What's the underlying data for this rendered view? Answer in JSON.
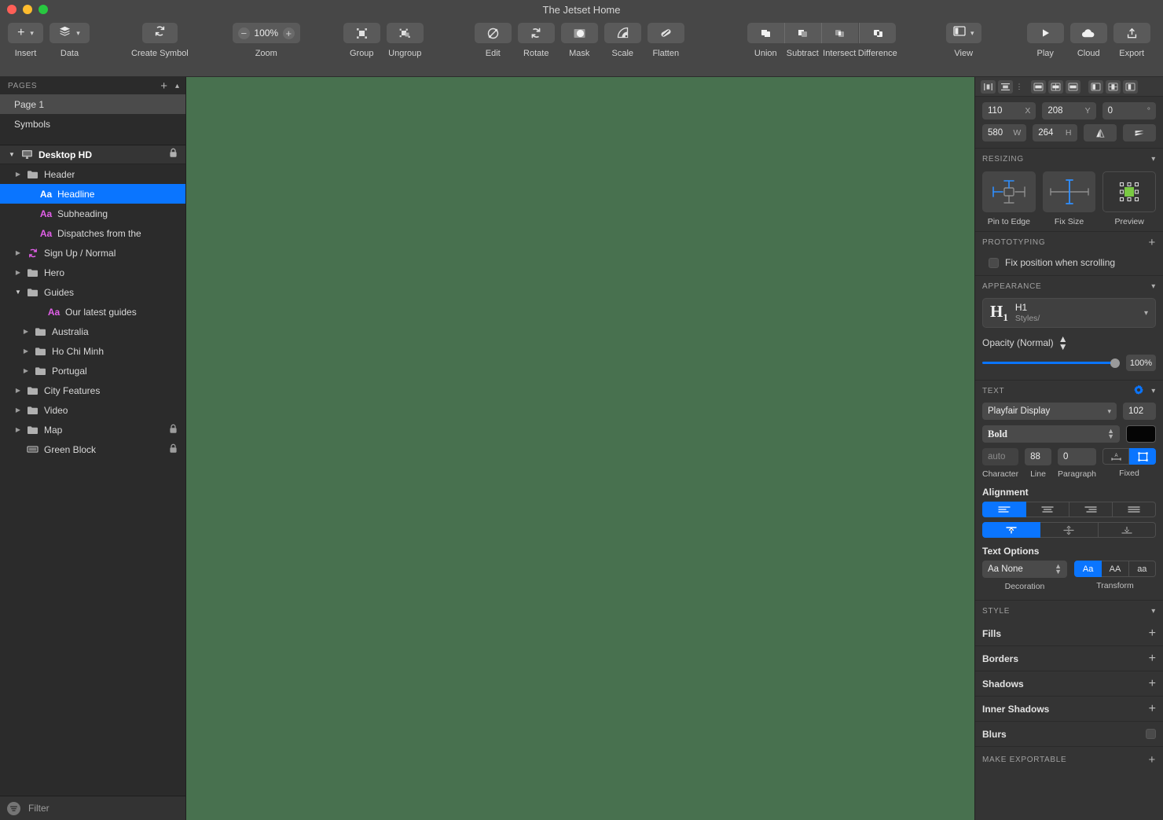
{
  "window": {
    "title": "The Jetset Home"
  },
  "toolbar": {
    "insert": {
      "label": "Insert",
      "icon": "plus-icon"
    },
    "data": {
      "label": "Data",
      "icon": "layers-icon"
    },
    "create_symbol": {
      "label": "Create Symbol",
      "icon": "symbol-icon"
    },
    "zoom": {
      "label": "Zoom",
      "value": "100%",
      "minus": "−",
      "plus": "+"
    },
    "group": {
      "label": "Group"
    },
    "ungroup": {
      "label": "Ungroup"
    },
    "edit": {
      "label": "Edit"
    },
    "rotate": {
      "label": "Rotate"
    },
    "mask": {
      "label": "Mask"
    },
    "scale": {
      "label": "Scale"
    },
    "flatten": {
      "label": "Flatten"
    },
    "union": {
      "label": "Union"
    },
    "subtract": {
      "label": "Subtract"
    },
    "intersect": {
      "label": "Intersect"
    },
    "difference": {
      "label": "Difference"
    },
    "view": {
      "label": "View"
    },
    "play": {
      "label": "Play"
    },
    "cloud": {
      "label": "Cloud"
    },
    "export": {
      "label": "Export"
    }
  },
  "sidebar": {
    "pages_header": "PAGES",
    "pages": [
      {
        "label": "Page 1",
        "selected": true
      },
      {
        "label": "Symbols",
        "selected": false
      }
    ],
    "artboard": {
      "label": "Desktop HD",
      "locked": true
    },
    "layers": [
      {
        "label": "Header",
        "type": "folder",
        "indent": 1,
        "arrow": "collapsed",
        "locked": false,
        "selected": false
      },
      {
        "label": "Headline",
        "type": "text",
        "indent": 2,
        "arrow": "none",
        "locked": false,
        "selected": true
      },
      {
        "label": "Subheading",
        "type": "text",
        "indent": 2,
        "arrow": "none",
        "locked": false,
        "selected": false
      },
      {
        "label": "Dispatches from the",
        "type": "text",
        "indent": 2,
        "arrow": "none",
        "locked": false,
        "selected": false
      },
      {
        "label": "Sign Up / Normal",
        "type": "symbol",
        "indent": 1,
        "arrow": "collapsed",
        "locked": false,
        "selected": false
      },
      {
        "label": "Hero",
        "type": "folder",
        "indent": 1,
        "arrow": "collapsed",
        "locked": false,
        "selected": false
      },
      {
        "label": "Guides",
        "type": "folder",
        "indent": 1,
        "arrow": "expanded",
        "locked": false,
        "selected": false
      },
      {
        "label": "Our latest guides",
        "type": "text",
        "indent": 2,
        "arrow": "none",
        "locked": false,
        "selected": false
      },
      {
        "label": "Australia",
        "type": "folder",
        "indent": 2,
        "arrow": "collapsed",
        "locked": false,
        "selected": false
      },
      {
        "label": "Ho Chi Minh",
        "type": "folder",
        "indent": 2,
        "arrow": "collapsed",
        "locked": false,
        "selected": false
      },
      {
        "label": "Portugal",
        "type": "folder",
        "indent": 2,
        "arrow": "collapsed",
        "locked": false,
        "selected": false
      },
      {
        "label": "City Features",
        "type": "folder",
        "indent": 1,
        "arrow": "collapsed",
        "locked": false,
        "selected": false
      },
      {
        "label": "Video",
        "type": "folder",
        "indent": 1,
        "arrow": "collapsed",
        "locked": false,
        "selected": false
      },
      {
        "label": "Map",
        "type": "folder",
        "indent": 1,
        "arrow": "collapsed",
        "locked": true,
        "selected": false
      },
      {
        "label": "Green Block",
        "type": "rect",
        "indent": 1,
        "arrow": "none",
        "locked": true,
        "selected": false
      }
    ],
    "filter_placeholder": "Filter"
  },
  "canvas": {
    "background": "#48714f"
  },
  "inspector": {
    "geometry": {
      "x": {
        "value": "110",
        "unit": "X"
      },
      "y": {
        "value": "208",
        "unit": "Y"
      },
      "rotation": {
        "value": "0",
        "unit": "°"
      },
      "w": {
        "value": "580",
        "unit": "W"
      },
      "h": {
        "value": "264",
        "unit": "H"
      }
    },
    "resizing": {
      "title": "RESIZING",
      "options": [
        {
          "label": "Pin to Edge",
          "active": true
        },
        {
          "label": "Fix Size",
          "active": true
        },
        {
          "label": "Preview",
          "active": false
        }
      ]
    },
    "prototyping": {
      "title": "PROTOTYPING",
      "fix_position_label": "Fix position when scrolling",
      "fix_position_checked": false
    },
    "appearance": {
      "title": "APPEARANCE",
      "style_glyph": "H1",
      "style_name": "H1",
      "style_path": "Styles/",
      "opacity_label": "Opacity (Normal)",
      "opacity_value": "100%"
    },
    "text": {
      "title": "TEXT",
      "font_family": "Playfair Display",
      "font_size": "102",
      "font_weight": "Bold",
      "color": "#000000",
      "character": "auto",
      "character_label": "Character",
      "line": "88",
      "line_label": "Line",
      "paragraph": "0",
      "paragraph_label": "Paragraph",
      "fixed_label": "Fixed",
      "alignment_title": "Alignment",
      "horizontal_active": "left",
      "vertical_active": "top",
      "options_title": "Text Options",
      "decoration_value": "Aa None",
      "decoration_label": "Decoration",
      "transform_label": "Transform",
      "transform_options": [
        {
          "label": "Aa",
          "active": true
        },
        {
          "label": "AA",
          "active": false
        },
        {
          "label": "aa",
          "active": false
        }
      ]
    },
    "style": {
      "title": "STYLE",
      "rows": [
        {
          "label": "Fills",
          "control": "plus"
        },
        {
          "label": "Borders",
          "control": "plus"
        },
        {
          "label": "Shadows",
          "control": "plus"
        },
        {
          "label": "Inner Shadows",
          "control": "plus"
        },
        {
          "label": "Blurs",
          "control": "checkbox"
        }
      ]
    },
    "make_exportable": {
      "title": "MAKE EXPORTABLE"
    }
  },
  "colors": {
    "accent": "#0a75ff",
    "canvas_green": "#48714f",
    "symbol_magenta": "#e15fe8"
  }
}
